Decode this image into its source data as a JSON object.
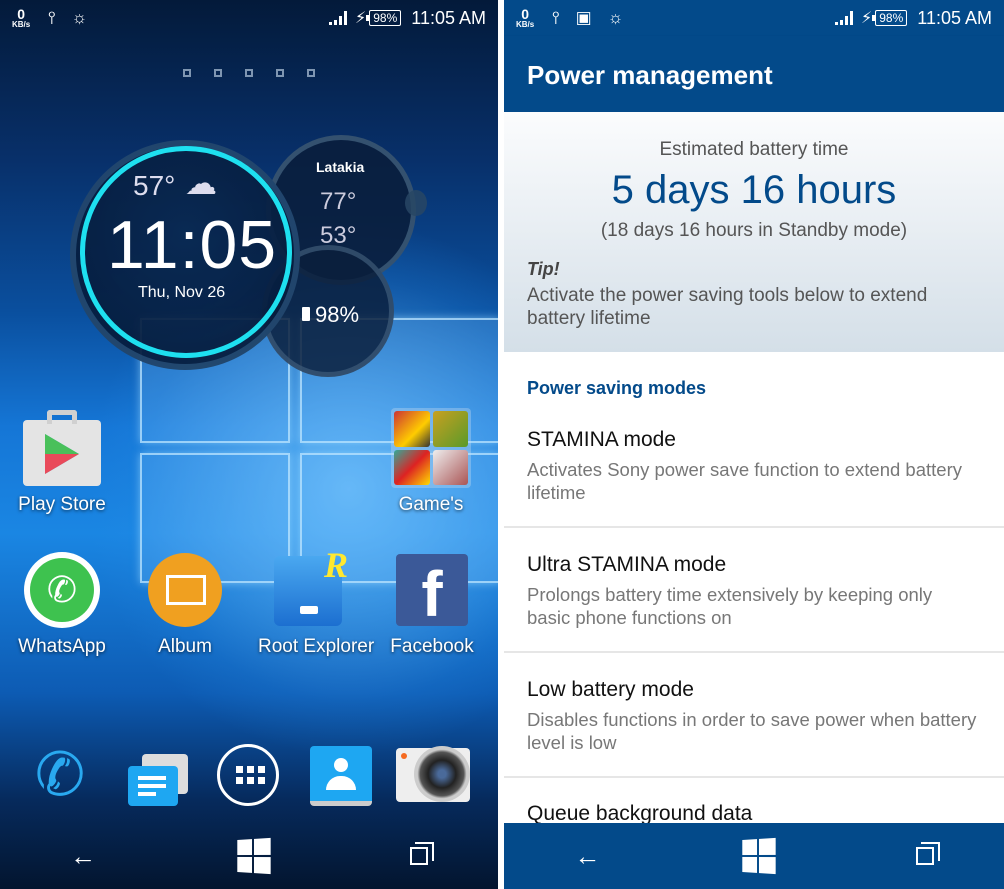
{
  "left_screen": {
    "status_bar": {
      "net_speed_value": "0",
      "net_speed_unit": "KB/s",
      "icons": [
        "usb-icon",
        "lightbulb-icon"
      ],
      "battery_percent": "98%",
      "time": "11:05 AM"
    },
    "page_indicator": {
      "pages": 5
    },
    "clock_widget": {
      "current_temp": "57°",
      "weather_icon": "night-cloudy-icon",
      "time": "11:05",
      "date": "Thu, Nov 26",
      "city": "Latakia",
      "high_temp": "77°",
      "low_temp": "53°",
      "battery_percent": "98%"
    },
    "apps": [
      {
        "label": "Play Store",
        "icon": "play-store-icon"
      },
      {
        "label": "Game's",
        "icon": "folder-icon"
      },
      {
        "label": "WhatsApp",
        "icon": "whatsapp-icon"
      },
      {
        "label": "Album",
        "icon": "album-icon"
      },
      {
        "label": "Root Explorer",
        "icon": "root-explorer-icon"
      },
      {
        "label": "Facebook",
        "icon": "facebook-icon"
      }
    ],
    "dock": [
      "phone-icon",
      "messaging-icon",
      "app-drawer-icon",
      "contacts-icon",
      "camera-icon"
    ],
    "navbar": {
      "back": "←",
      "home": "windows-home-icon",
      "recents": "recents-icon"
    }
  },
  "right_screen": {
    "status_bar": {
      "net_speed_value": "0",
      "net_speed_unit": "KB/s",
      "icons": [
        "usb-icon",
        "image-icon",
        "lightbulb-icon"
      ],
      "battery_percent": "98%",
      "time": "11:05 AM"
    },
    "header": {
      "title": "Power management"
    },
    "summary": {
      "label": "Estimated battery time",
      "value": "5 days 16 hours",
      "standby": "(18 days 16 hours in Standby mode)",
      "tip_label": "Tip!",
      "tip_text": "Activate the power saving tools below to extend battery lifetime"
    },
    "section_title": "Power saving modes",
    "modes": [
      {
        "title": "STAMINA mode",
        "desc": "Activates Sony power save function to extend battery lifetime"
      },
      {
        "title": "Ultra STAMINA mode",
        "desc": "Prolongs battery time extensively by keeping only basic phone functions on"
      },
      {
        "title": "Low battery mode",
        "desc": "Disables functions in order to save power when battery level is low"
      },
      {
        "title": "Queue background data",
        "desc": ""
      }
    ],
    "navbar": {
      "back": "←",
      "home": "windows-home-icon",
      "recents": "recents-icon"
    },
    "colors": {
      "primary": "#034a8a"
    }
  }
}
